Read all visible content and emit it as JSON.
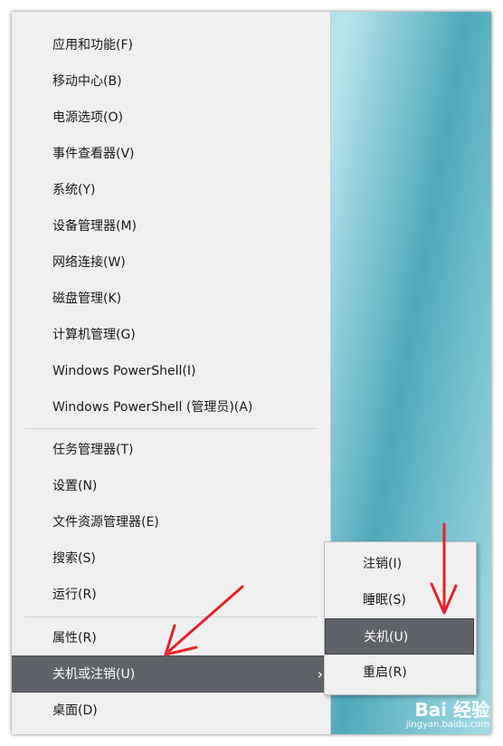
{
  "menu": {
    "group1": [
      {
        "label": "应用和功能(F)"
      },
      {
        "label": "移动中心(B)"
      },
      {
        "label": "电源选项(O)"
      },
      {
        "label": "事件查看器(V)"
      },
      {
        "label": "系统(Y)"
      },
      {
        "label": "设备管理器(M)"
      },
      {
        "label": "网络连接(W)"
      },
      {
        "label": "磁盘管理(K)"
      },
      {
        "label": "计算机管理(G)"
      },
      {
        "label": "Windows PowerShell(I)"
      },
      {
        "label": "Windows PowerShell (管理员)(A)"
      }
    ],
    "group2": [
      {
        "label": "任务管理器(T)"
      },
      {
        "label": "设置(N)"
      },
      {
        "label": "文件资源管理器(E)"
      },
      {
        "label": "搜索(S)"
      },
      {
        "label": "运行(R)"
      }
    ],
    "group3": [
      {
        "label": "属性(R)"
      },
      {
        "label": "关机或注销(U)"
      },
      {
        "label": "桌面(D)"
      }
    ],
    "submenu_chevron": "›"
  },
  "submenu": {
    "items": [
      {
        "label": "注销(I)"
      },
      {
        "label": "睡眠(S)"
      },
      {
        "label": "关机(U)"
      },
      {
        "label": "重启(R)"
      }
    ]
  },
  "watermark": {
    "brand": "Bai 经验",
    "url": "jingyan.baidu.com"
  },
  "colors": {
    "highlight": "#5f6268",
    "arrow": "#e8212b"
  }
}
